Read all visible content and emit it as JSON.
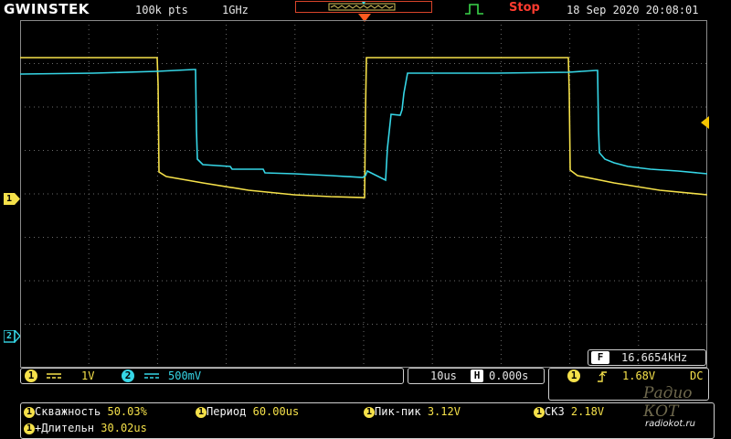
{
  "header": {
    "brand": "GWINSTEK",
    "record_length": "100k pts",
    "sample_rate": "1GHz",
    "run_state": "Stop",
    "datetime": "18 Sep 2020 20:08:01"
  },
  "channels": {
    "ch1_marker": "1",
    "ch2_marker": "2"
  },
  "frequency": {
    "badge": "F",
    "value": "16.6654kHz"
  },
  "status_bar": {
    "ch1_num": "1",
    "ch1_scale": "1V",
    "ch2_num": "2",
    "ch2_scale": "500mV",
    "timebase": "10us",
    "h_icon": "H",
    "h_position": "0.000s",
    "trig_num": "1",
    "trig_level": "1.68V",
    "trig_coupling": "DC"
  },
  "measurements": [
    {
      "label": "Скважность",
      "value": "50.03%"
    },
    {
      "label": "Период",
      "value": "60.00us"
    },
    {
      "label": "Пик-пик",
      "value": "3.12V"
    },
    {
      "label": "СКЗ",
      "value": "2.18V"
    },
    {
      "label": "+Длительн",
      "value": "30.02us"
    }
  ],
  "meas_chip": "1",
  "watermark": {
    "brand": "Радио КОТ",
    "url": "radiokot.ru"
  },
  "colors": {
    "ch1": "#f5e14a",
    "ch2": "#36d6e6",
    "stop": "#ff3b2f",
    "trigger": "#ff5a1f",
    "grid": "#6b6b6b"
  }
}
